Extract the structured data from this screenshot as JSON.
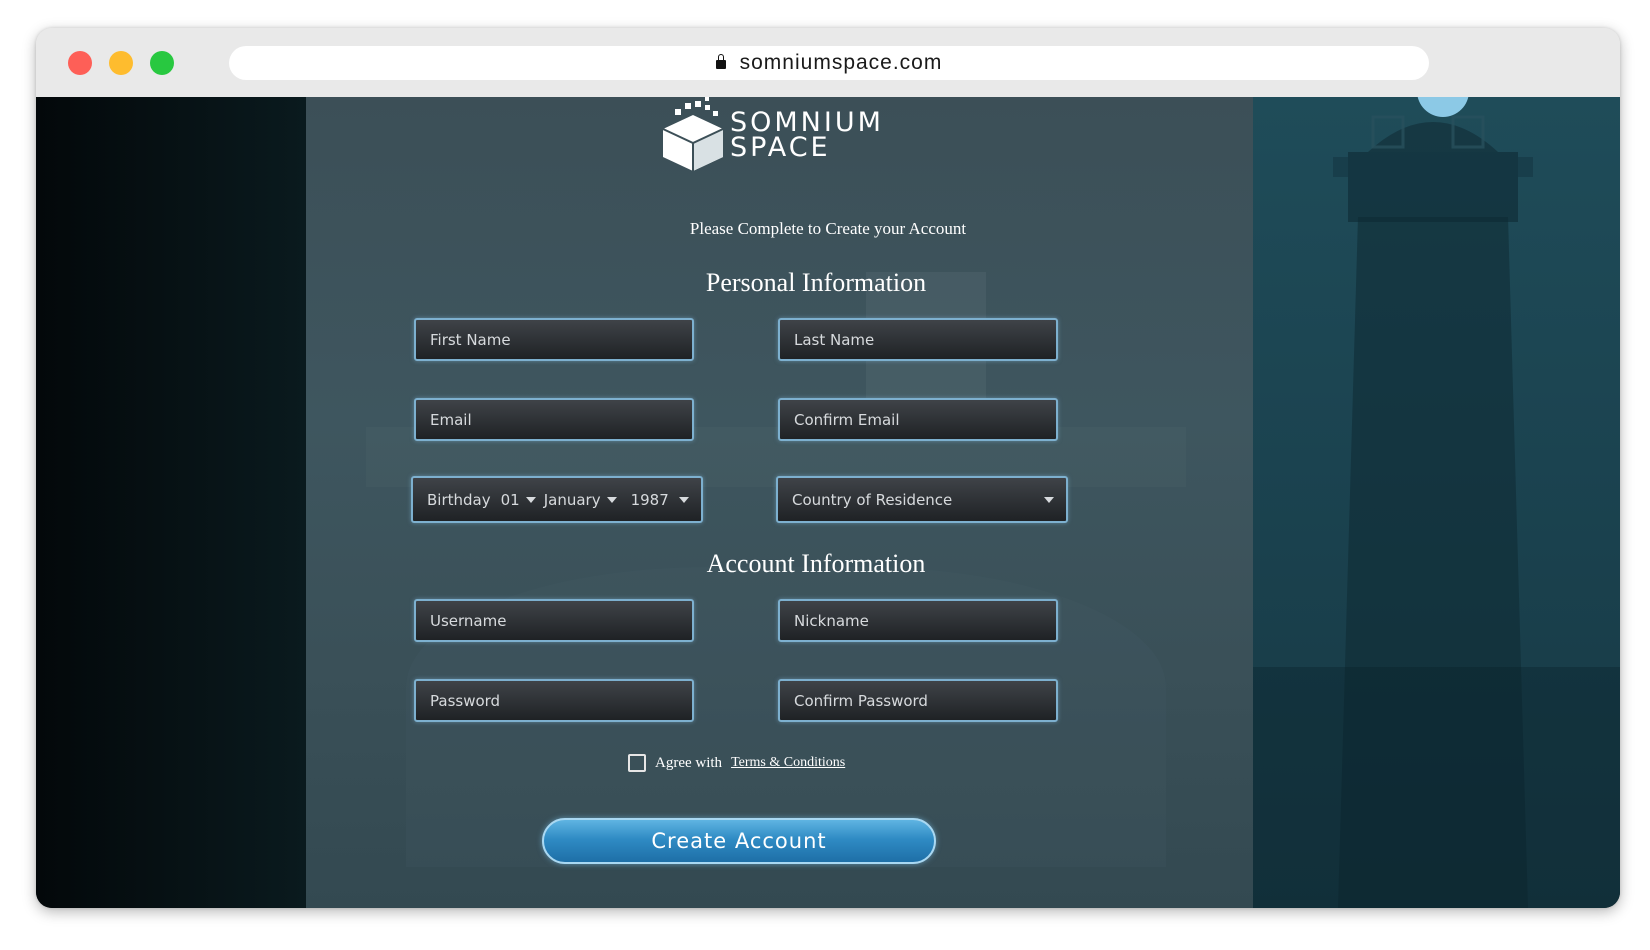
{
  "browser": {
    "url": "somniumspace.com"
  },
  "brand": {
    "line1": "SOMNIUM",
    "line2": "SPACE"
  },
  "form": {
    "subtitle": "Please Complete to Create your Account",
    "personal_title": "Personal Information",
    "account_title": "Account Information",
    "first_name_placeholder": "First Name",
    "last_name_placeholder": "Last Name",
    "email_placeholder": "Email",
    "confirm_email_placeholder": "Confirm Email",
    "birthday_label": "Birthday",
    "birthday_day": "01",
    "birthday_month": "January",
    "birthday_year": "1987",
    "country_placeholder": "Country of Residence",
    "username_placeholder": "Username",
    "nickname_placeholder": "Nickname",
    "password_placeholder": "Password",
    "confirm_password_placeholder": "Confirm Password",
    "agree_label": "Agree with",
    "terms_link": "Terms & Conditions",
    "submit_label": "Create Account"
  },
  "colors": {
    "field_border": "#7db0cf",
    "button_blue": "#2f8bc4",
    "traffic_red": "#fe5f57",
    "traffic_yellow": "#febc2e",
    "traffic_green": "#28c840"
  }
}
